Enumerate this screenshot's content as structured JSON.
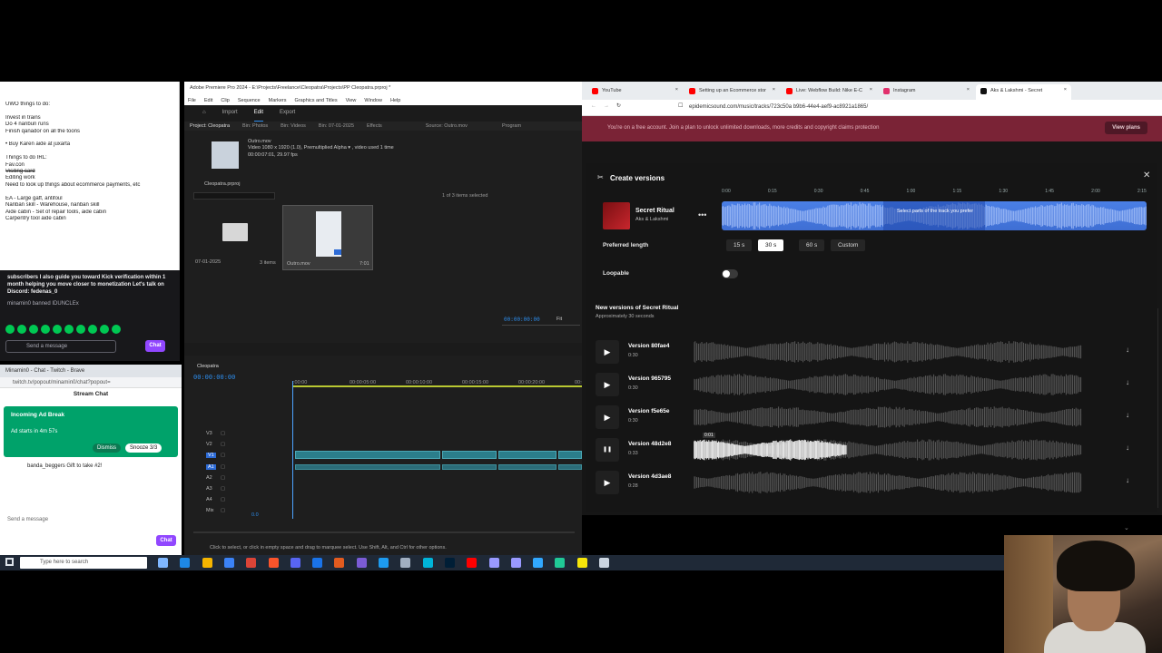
{
  "notes": {
    "lines": [
      {
        "text": "UWO things to do:",
        "strike": false
      },
      {
        "text": "",
        "strike": false
      },
      {
        "text": "Invest in trains",
        "strike": false
      },
      {
        "text": "Do 4 nanbun runs",
        "strike": false
      },
      {
        "text": "Finish qanador on all the toons",
        "strike": false
      },
      {
        "text": "",
        "strike": false
      },
      {
        "text": "• Buy Karen aide at juxarta",
        "strike": false
      },
      {
        "text": "",
        "strike": false
      },
      {
        "text": "Things to do IRL:",
        "strike": false
      },
      {
        "text": "Fav.con",
        "strike": false
      },
      {
        "text": "Visiting card",
        "strike": true
      },
      {
        "text": "Editing work",
        "strike": false
      },
      {
        "text": "Need to look up things about ecommerce payments, etc",
        "strike": false
      },
      {
        "text": "",
        "strike": false
      },
      {
        "text": "EA - Large gaff, antifoul",
        "strike": false
      },
      {
        "text": "Nanban skill - Warehouse, nanban skill",
        "strike": false
      },
      {
        "text": "Aide cabin - Set of repair tools, aide cabin",
        "strike": false
      },
      {
        "text": "Carpentry tool aide cabin",
        "strike": false
      }
    ]
  },
  "twitch_overlay": {
    "message": "subscribers I also guide you toward Kick verification within 1 month helping you move closer to monetization Let's talk on Discord: fedenas_0",
    "ban_text": "minamin0 banned IDUNCLEx",
    "send_placeholder": "Send a message",
    "chat_label": "Chat"
  },
  "twitch_window": {
    "title": "Minamin0 - Chat - Twitch - Brave",
    "url": "twitch.tv/popout/minamin0/chat?popout=",
    "header": "Stream Chat",
    "ad_title": "Incoming Ad Break",
    "ad_sub": "Ad starts in 4m 57s",
    "dismiss": "Dismiss",
    "snooze": "Snooze 3/3",
    "gift_user": "banda_beggers",
    "gift_text": "Gift to take #2!",
    "send_placeholder": "Send a message",
    "chat_label": "Chat"
  },
  "premiere": {
    "title": "Adobe Premiere Pro 2024 - E:\\Projects\\Freelance\\Cleopatra\\Projects\\PP Cleopatra.prproj *",
    "menu": [
      "File",
      "Edit",
      "Clip",
      "Sequence",
      "Markers",
      "Graphics and Titles",
      "View",
      "Window",
      "Help"
    ],
    "modes": [
      "Import",
      "Edit",
      "Export"
    ],
    "active_mode": "Edit",
    "panel_tabs": [
      "Project: Cleopatra",
      "Bin: Photos",
      "Bin: Videos",
      "Bin: 07-01-2025",
      "Effects"
    ],
    "source_tab": "Source: Outro.mov",
    "program_tab": "Program",
    "clip_name": "Outro.mov",
    "clip_meta": "Video 1080 x 1920 (1.0), Premultiplied Alpha ▾ , video used 1 time",
    "clip_meta2": "00:00:07:01, 29.97 fps",
    "project_file": "Cleopatra.prproj",
    "items_selected": "1 of 3 items selected",
    "folder_name": "07-01-2025",
    "folder_items": "3 items",
    "thumb_name": "Outro.mov",
    "thumb_dur": "7:01",
    "source_time": "00:00:00:00",
    "fit": "Fit",
    "sequence_tab": "Cleopatra",
    "timeline_time": "00:00:00:00",
    "ruler": [
      ":00:00",
      "00:00:05:00",
      "00:00:10:00",
      "00:00:15:00",
      "00:00:20:00",
      "00:00:25:00"
    ],
    "tracks": [
      "V3",
      "V2",
      "V1",
      "A1",
      "A2",
      "A3",
      "A4",
      "Mix"
    ],
    "mix_val": "0.0",
    "status": "Click to select, or click in empty space and drag to marquee select. Use Shift, Alt, and Ctrl for other options."
  },
  "browser": {
    "tabs": [
      {
        "label": "YouTube",
        "color": "#ff0000",
        "active": false
      },
      {
        "label": "Setting up an Ecommerce stor",
        "color": "#ff0000",
        "active": false
      },
      {
        "label": "Live: Webflow Build: Nike E-C",
        "color": "#ff0000",
        "active": false
      },
      {
        "label": "Instagram",
        "color": "#e1306c",
        "active": false
      },
      {
        "label": "Aks & Lakshmi - Secret",
        "color": "#111111",
        "active": true
      }
    ],
    "url": "epidemicsound.com/music/tracks/723c50a b9b6-44e4-aef9-ac8921a1865/",
    "banner": "You're on a free account. Join a plan to unlock unlimited downloads, more credits and copyright claims protection",
    "plans": "View plans"
  },
  "create_versions": {
    "title": "Create versions",
    "track_title": "Secret Ritual",
    "track_artist": "Aks & Lakshmi",
    "timeline_ticks": [
      "0:00",
      "0:15",
      "0:30",
      "0:45",
      "1:00",
      "1:15",
      "1:30",
      "1:45",
      "2:00",
      "2:15"
    ],
    "hint": "Select parts of the track you prefer",
    "preferred_length_label": "Preferred length",
    "lengths": [
      "15 s",
      "30 s",
      "60 s",
      "Custom"
    ],
    "selected_length": "30 s",
    "loopable_label": "Loopable",
    "new_versions_title": "New versions of Secret Ritual",
    "new_versions_sub": "Approximately 30 seconds",
    "versions": [
      {
        "name": "Version 80fae4",
        "duration": "0:30",
        "playing": false
      },
      {
        "name": "Version 965795",
        "duration": "0:30",
        "playing": false
      },
      {
        "name": "Version f5e65e",
        "duration": "0:30",
        "playing": false
      },
      {
        "name": "Version 48d2e8",
        "duration": "0:33",
        "playing": true
      },
      {
        "name": "Version 4d3ae8",
        "duration": "0:28",
        "playing": false
      }
    ],
    "play_time": "0:01"
  },
  "taskbar": {
    "search_placeholder": "Type here to search"
  },
  "colors": {
    "accent_blue": "#4a7fe6",
    "banner": "#7a2336",
    "twitch_purple": "#9147ff",
    "ad_green": "#00a26a"
  }
}
